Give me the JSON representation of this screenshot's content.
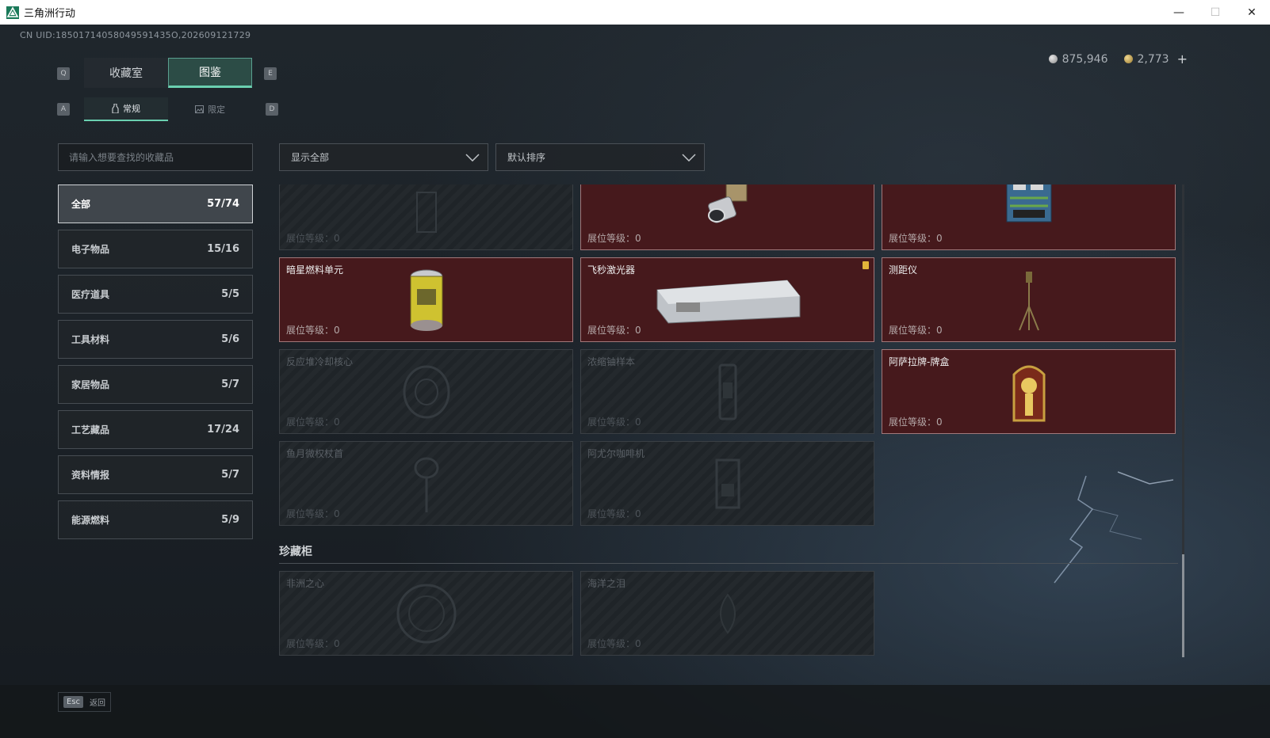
{
  "window": {
    "title": "三角洲行动"
  },
  "uid": "CN UID:18501714058049591435O,202609121729",
  "currency": {
    "silver": "875,946",
    "gold": "2,773",
    "plus": "+"
  },
  "keys": {
    "prev_tab": "Q",
    "next_tab": "E",
    "prev_sub": "A",
    "next_sub": "D",
    "back_key": "Esc"
  },
  "tabs": [
    {
      "label": "收藏室"
    },
    {
      "label": "图鉴"
    }
  ],
  "subtabs": [
    {
      "label": "常规"
    },
    {
      "label": "限定"
    }
  ],
  "search": {
    "placeholder": "请输入想要查找的收藏品"
  },
  "categories": [
    {
      "label": "全部",
      "count": "57/74"
    },
    {
      "label": "电子物品",
      "count": "15/16"
    },
    {
      "label": "医疗道具",
      "count": "5/5"
    },
    {
      "label": "工具材料",
      "count": "5/6"
    },
    {
      "label": "家居物品",
      "count": "5/7"
    },
    {
      "label": "工艺藏品",
      "count": "17/24"
    },
    {
      "label": "资料情报",
      "count": "5/7"
    },
    {
      "label": "能源燃料",
      "count": "5/9"
    }
  ],
  "filters": {
    "show": "显示全部",
    "sort": "默认排序"
  },
  "level_label": "展位等级：",
  "items": [
    {
      "name": "",
      "level": "0",
      "owned": false,
      "icon": "faded-item-icon"
    },
    {
      "name": "",
      "level": "0",
      "owned": true,
      "icon": "lens-device-icon"
    },
    {
      "name": "",
      "level": "0",
      "owned": true,
      "icon": "circuit-box-icon"
    },
    {
      "name": "暗星燃料单元",
      "level": "0",
      "owned": true,
      "icon": "fuel-canister-icon"
    },
    {
      "name": "飞秒激光器",
      "level": "0",
      "owned": true,
      "icon": "laser-case-icon",
      "badge": true
    },
    {
      "name": "测距仪",
      "level": "0",
      "owned": true,
      "icon": "tripod-icon"
    },
    {
      "name": "反应堆冷却核心",
      "level": "0",
      "owned": false,
      "icon": "cooling-core-icon"
    },
    {
      "name": "浓缩铀样本",
      "level": "0",
      "owned": false,
      "icon": "uranium-sample-icon"
    },
    {
      "name": "阿萨拉牌-牌盒",
      "level": "0",
      "owned": true,
      "icon": "card-box-icon"
    },
    {
      "name": "鱼月微权杖首",
      "level": "0",
      "owned": false,
      "icon": "scepter-icon"
    },
    {
      "name": "阿尤尔咖啡机",
      "level": "0",
      "owned": false,
      "icon": "coffee-machine-icon"
    }
  ],
  "treasure": {
    "title": "珍藏柜",
    "items": [
      {
        "name": "非洲之心",
        "level": "0",
        "owned": false,
        "icon": "gem-heart-icon"
      },
      {
        "name": "海洋之泪",
        "level": "0",
        "owned": false,
        "icon": "ocean-tear-icon"
      }
    ]
  },
  "footer": {
    "back_label": "返回"
  }
}
